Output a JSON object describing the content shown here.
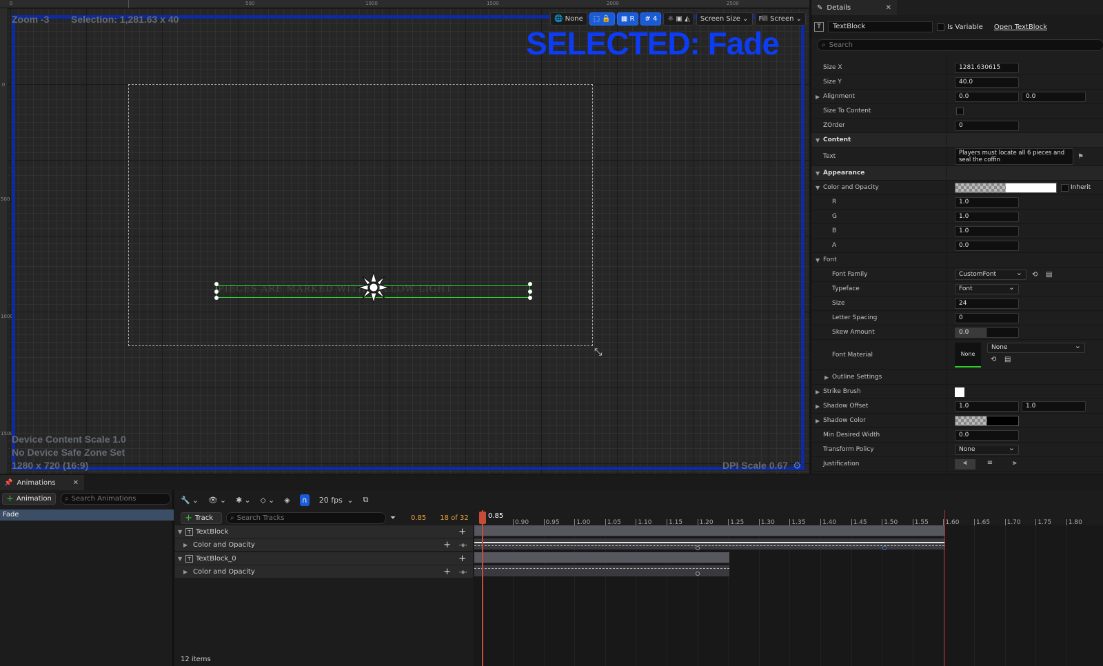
{
  "viewport": {
    "zoom": "Zoom -3",
    "selection": "Selection: 1,281.63 x 40",
    "selected_label": "SELECTED: Fade",
    "widget_text": "PIECES ARE MARKED WITH YELLOW LIGHT",
    "device_scale": "Device Content Scale 1.0",
    "safe_zone": "No Device Safe Zone Set",
    "resolution": "1280 x 720 (16:9)",
    "dpi_scale": "DPI Scale 0.67",
    "ruler_top": [
      "0",
      "500",
      "1000",
      "1500",
      "2000",
      "2500"
    ],
    "ruler_left": [
      "0",
      "500",
      "1000",
      "1500"
    ],
    "toolbar": {
      "none_label": "None",
      "r_label": "R",
      "grid_value": "4",
      "screen_size": "Screen Size",
      "fill_screen": "Fill Screen"
    }
  },
  "details": {
    "tab_title": "Details",
    "widget_name": "TextBlock",
    "is_variable": "Is Variable",
    "open_link": "Open TextBlock",
    "search_placeholder": "Search",
    "size_x_label": "Size X",
    "size_x": "1281.630615",
    "size_y_label": "Size Y",
    "size_y": "40.0",
    "alignment_label": "Alignment",
    "alignment_x": "0.0",
    "alignment_y": "0.0",
    "size_to_content": "Size To Content",
    "zorder_label": "ZOrder",
    "zorder": "0",
    "content_cat": "Content",
    "text_label": "Text",
    "text_value": "Players must locate all 6 pieces and seal the coffin",
    "appearance_cat": "Appearance",
    "color_opacity_label": "Color and Opacity",
    "inherit": "Inherit",
    "r_label": "R",
    "r": "1.0",
    "g_label": "G",
    "g": "1.0",
    "b_label": "B",
    "b": "1.0",
    "a_label": "A",
    "a": "0.0",
    "font_cat": "Font",
    "font_family_label": "Font Family",
    "font_family": "CustomFont",
    "typeface_label": "Typeface",
    "typeface": "Font",
    "size_label": "Size",
    "size": "24",
    "letter_spacing_label": "Letter Spacing",
    "letter_spacing": "0",
    "skew_label": "Skew Amount",
    "skew": "0.0",
    "font_material_label": "Font Material",
    "font_material_thumb": "None",
    "font_material": "None",
    "outline_label": "Outline Settings",
    "strike_label": "Strike Brush",
    "shadow_offset_label": "Shadow Offset",
    "shadow_offset_x": "1.0",
    "shadow_offset_y": "1.0",
    "shadow_color_label": "Shadow Color",
    "min_width_label": "Min Desired Width",
    "min_width": "0.0",
    "transform_label": "Transform Policy",
    "transform": "None",
    "justification_label": "Justification"
  },
  "animations": {
    "tab_title": "Animations",
    "add_label": "Animation",
    "search_placeholder": "Search Animations",
    "items": [
      "Fade"
    ]
  },
  "sequencer": {
    "fps": "20 fps",
    "add_track": "Track",
    "search_placeholder": "Search Tracks",
    "current_time": "0.85",
    "frame_count": "18 of 32",
    "playhead_label": "0.85",
    "tracks": [
      {
        "name": "TextBlock",
        "type": "object"
      },
      {
        "name": "Color and Opacity",
        "type": "property"
      },
      {
        "name": "TextBlock_0",
        "type": "object"
      },
      {
        "name": "Color and Opacity",
        "type": "property"
      }
    ],
    "items_count": "12 items",
    "ticks": [
      "0.90",
      "0.95",
      "1.00",
      "1.05",
      "1.10",
      "1.15",
      "1.20",
      "1.25",
      "1.30",
      "1.35",
      "1.40",
      "1.45",
      "1.50",
      "1.55",
      "1.60",
      "1.65",
      "1.70",
      "1.75",
      "1.80"
    ]
  }
}
